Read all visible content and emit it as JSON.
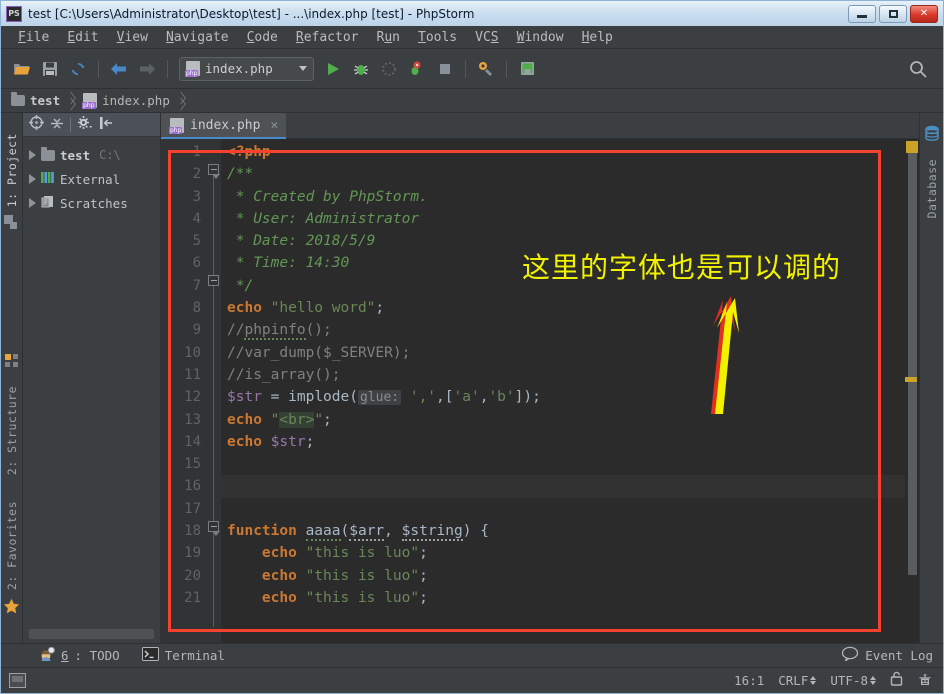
{
  "window": {
    "title": "test [C:\\Users\\Administrator\\Desktop\\test] - ...\\index.php [test] - PhpStorm",
    "app_icon": "PS",
    "controls": {
      "minimize": "minimize-button",
      "maximize": "maximize-button",
      "close": "✕"
    }
  },
  "menubar": {
    "items": [
      {
        "mnemonic": "F",
        "rest": "ile"
      },
      {
        "mnemonic": "E",
        "rest": "dit"
      },
      {
        "mnemonic": "V",
        "rest": "iew"
      },
      {
        "mnemonic": "N",
        "rest": "avigate"
      },
      {
        "mnemonic": "C",
        "rest": "ode"
      },
      {
        "mnemonic": "R",
        "rest": "efactor"
      },
      {
        "mnemonic": "R",
        "rest": "un",
        "prefix": "R",
        "label": "Run"
      },
      {
        "mnemonic": "T",
        "rest": "ools"
      },
      {
        "mnemonic": "S",
        "rest": "VCS",
        "label": "VCS"
      },
      {
        "mnemonic": "W",
        "rest": "indow"
      },
      {
        "mnemonic": "H",
        "rest": "elp"
      }
    ],
    "labels": [
      "File",
      "Edit",
      "View",
      "Navigate",
      "Code",
      "Refactor",
      "Run",
      "Tools",
      "VCS",
      "Window",
      "Help"
    ]
  },
  "toolbar": {
    "open_label": "open-project",
    "save_label": "save-all",
    "sync_label": "synchronize",
    "back_label": "navigate-back",
    "forward_label": "navigate-forward",
    "run_config": {
      "name": "index.php"
    },
    "run_label": "Run",
    "debug_label": "Debug",
    "coverage_label": "Run with Coverage",
    "profile_label": "Profile",
    "stop_label": "Stop",
    "settings_label": "Settings",
    "structure_label": "Project Structure",
    "search_label": "Search Everywhere"
  },
  "breadcrumb": {
    "items": [
      {
        "label": "test",
        "icon": "folder-icon"
      },
      {
        "label": "index.php",
        "icon": "php-file-icon"
      }
    ]
  },
  "left_strip": {
    "top_tab": "1: Project",
    "tabs": [
      "2: Structure",
      "2: Favorites"
    ]
  },
  "right_strip": {
    "tab": "Database"
  },
  "project_panel": {
    "toolbar": [
      "locate-icon",
      "collapse-all-icon",
      "settings-icon",
      "hide-icon"
    ],
    "tree": [
      {
        "label": "test",
        "detail": "C:\\",
        "icon": "folder-icon",
        "expandable": true,
        "bold": true
      },
      {
        "label": "External",
        "detail": "",
        "icon": "library-icon",
        "expandable": true,
        "bold": false
      },
      {
        "label": "Scratches",
        "detail": "",
        "icon": "scratches-icon",
        "expandable": true,
        "bold": false
      }
    ]
  },
  "editor": {
    "tab": {
      "label": "index.php",
      "icon": "php-file-icon",
      "close": "✕"
    },
    "line_numbers": [
      "1",
      "2",
      "3",
      "4",
      "5",
      "6",
      "7",
      "8",
      "9",
      "10",
      "11",
      "12",
      "13",
      "14",
      "15",
      "16",
      "17",
      "18",
      "19",
      "20",
      "21"
    ],
    "current_line": 16,
    "lines": [
      {
        "n": 1,
        "tokens": [
          {
            "t": "<?php",
            "c": "kw"
          }
        ]
      },
      {
        "n": 2,
        "tokens": [
          {
            "t": "/**",
            "c": "cmt"
          }
        ]
      },
      {
        "n": 3,
        "tokens": [
          {
            "t": " * Created by PhpStorm.",
            "c": "cmt"
          }
        ]
      },
      {
        "n": 4,
        "tokens": [
          {
            "t": " * User: Administrator",
            "c": "cmt"
          }
        ]
      },
      {
        "n": 5,
        "tokens": [
          {
            "t": " * Date: 2018/5/9",
            "c": "cmt"
          }
        ]
      },
      {
        "n": 6,
        "tokens": [
          {
            "t": " * Time: 14:30",
            "c": "cmt"
          }
        ]
      },
      {
        "n": 7,
        "tokens": [
          {
            "t": " */",
            "c": "cmt"
          }
        ]
      },
      {
        "n": 8,
        "tokens": [
          {
            "t": "echo",
            "c": "kw"
          },
          {
            "t": " ",
            "c": "punc"
          },
          {
            "t": "\"hello word\"",
            "c": "str"
          },
          {
            "t": ";",
            "c": "punc"
          }
        ]
      },
      {
        "n": 9,
        "tokens": [
          {
            "t": "//phpinfo();",
            "c": "lcmt"
          }
        ]
      },
      {
        "n": 10,
        "tokens": [
          {
            "t": "//var_dump($_SERVER);",
            "c": "lcmt"
          }
        ]
      },
      {
        "n": 11,
        "tokens": [
          {
            "t": "//is_array();",
            "c": "lcmt"
          }
        ]
      },
      {
        "n": 12,
        "tokens": [
          {
            "t": "$str",
            "c": "var"
          },
          {
            "t": " = ",
            "c": "punc"
          },
          {
            "t": "implode(",
            "c": "punc"
          },
          {
            "t": "glue:",
            "c": "hint"
          },
          {
            "t": " ",
            "c": "punc"
          },
          {
            "t": "','",
            "c": "str"
          },
          {
            "t": ",[",
            "c": "punc"
          },
          {
            "t": "'a'",
            "c": "str"
          },
          {
            "t": ",",
            "c": "punc"
          },
          {
            "t": "'b'",
            "c": "str"
          },
          {
            "t": "]);",
            "c": "punc"
          }
        ]
      },
      {
        "n": 13,
        "tokens": [
          {
            "t": "echo",
            "c": "kw"
          },
          {
            "t": " ",
            "c": "punc"
          },
          {
            "t": "\"",
            "c": "str"
          },
          {
            "t": "<br>",
            "c": "sel"
          },
          {
            "t": "\"",
            "c": "str"
          },
          {
            "t": ";",
            "c": "punc"
          }
        ]
      },
      {
        "n": 14,
        "tokens": [
          {
            "t": "echo",
            "c": "kw"
          },
          {
            "t": " ",
            "c": "punc"
          },
          {
            "t": "$str",
            "c": "var"
          },
          {
            "t": ";",
            "c": "punc"
          }
        ]
      },
      {
        "n": 15,
        "tokens": []
      },
      {
        "n": 16,
        "tokens": []
      },
      {
        "n": 17,
        "tokens": []
      },
      {
        "n": 18,
        "tokens": [
          {
            "t": "function",
            "c": "kw"
          },
          {
            "t": " ",
            "c": "punc"
          },
          {
            "t": "aaaa",
            "c": "squig"
          },
          {
            "t": "(",
            "c": "punc"
          },
          {
            "t": "$arr",
            "c": "squig-g"
          },
          {
            "t": ", ",
            "c": "punc"
          },
          {
            "t": "$string",
            "c": "squig-g"
          },
          {
            "t": ") {",
            "c": "punc"
          }
        ]
      },
      {
        "n": 19,
        "tokens": [
          {
            "t": "    ",
            "c": "punc"
          },
          {
            "t": "echo",
            "c": "kw"
          },
          {
            "t": " ",
            "c": "punc"
          },
          {
            "t": "\"this is luo\"",
            "c": "str"
          },
          {
            "t": ";",
            "c": "punc"
          }
        ]
      },
      {
        "n": 20,
        "tokens": [
          {
            "t": "    ",
            "c": "punc"
          },
          {
            "t": "echo",
            "c": "kw"
          },
          {
            "t": " ",
            "c": "punc"
          },
          {
            "t": "\"this is luo\"",
            "c": "str"
          },
          {
            "t": ";",
            "c": "punc"
          }
        ]
      },
      {
        "n": 21,
        "tokens": [
          {
            "t": "    ",
            "c": "punc"
          },
          {
            "t": "echo",
            "c": "kw"
          },
          {
            "t": " ",
            "c": "punc"
          },
          {
            "t": "\"this is luo\"",
            "c": "str"
          },
          {
            "t": ";",
            "c": "punc"
          }
        ]
      }
    ]
  },
  "bottom_bar": {
    "todo": {
      "number": "6",
      "label": ": TODO"
    },
    "terminal": {
      "label": "Terminal"
    },
    "event_log": {
      "label": "Event Log"
    }
  },
  "statusbar": {
    "caret": "16:1",
    "line_separator": "CRLF",
    "encoding": "UTF-8",
    "lock_icon": "lock-icon",
    "inspection_icon": "hector-icon"
  },
  "annotations": {
    "text": "这里的字体也是可以调的",
    "rect_color": "#f4422e",
    "text_color": "#f2f200",
    "arrow_color": "#f2f200",
    "arrow_shadow_color": "#e03020"
  }
}
